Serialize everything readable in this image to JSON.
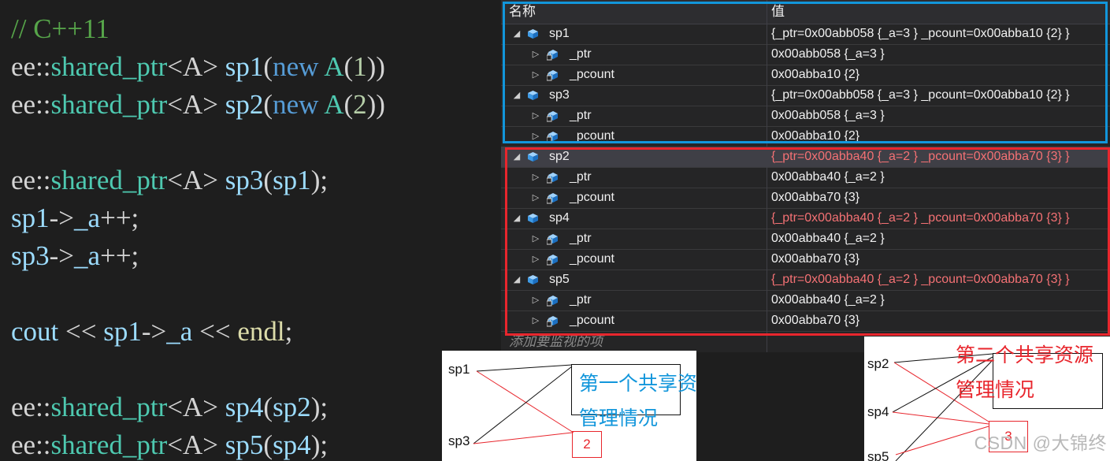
{
  "code": {
    "lines": [
      [
        {
          "t": "// C++11",
          "c": "comment"
        }
      ],
      [
        {
          "t": "ee",
          "c": "ns"
        },
        {
          "t": "::",
          "c": "op"
        },
        {
          "t": "shared_ptr",
          "c": "type"
        },
        {
          "t": "<A>",
          "c": "tpl"
        },
        {
          "t": " ",
          "c": "op"
        },
        {
          "t": "sp1",
          "c": "var"
        },
        {
          "t": "(",
          "c": "op"
        },
        {
          "t": "new",
          "c": "kw"
        },
        {
          "t": " ",
          "c": "op"
        },
        {
          "t": "A",
          "c": "type"
        },
        {
          "t": "(",
          "c": "op"
        },
        {
          "t": "1",
          "c": "num"
        },
        {
          "t": "))",
          "c": "op"
        }
      ],
      [
        {
          "t": "ee",
          "c": "ns"
        },
        {
          "t": "::",
          "c": "op"
        },
        {
          "t": "shared_ptr",
          "c": "type"
        },
        {
          "t": "<A>",
          "c": "tpl"
        },
        {
          "t": " ",
          "c": "op"
        },
        {
          "t": "sp2",
          "c": "var"
        },
        {
          "t": "(",
          "c": "op"
        },
        {
          "t": "new",
          "c": "kw"
        },
        {
          "t": " ",
          "c": "op"
        },
        {
          "t": "A",
          "c": "type"
        },
        {
          "t": "(",
          "c": "op"
        },
        {
          "t": "2",
          "c": "num"
        },
        {
          "t": "))",
          "c": "op"
        }
      ],
      [],
      [
        {
          "t": "ee",
          "c": "ns"
        },
        {
          "t": "::",
          "c": "op"
        },
        {
          "t": "shared_ptr",
          "c": "type"
        },
        {
          "t": "<A>",
          "c": "tpl"
        },
        {
          "t": " ",
          "c": "op"
        },
        {
          "t": "sp3",
          "c": "var"
        },
        {
          "t": "(",
          "c": "op"
        },
        {
          "t": "sp1",
          "c": "var"
        },
        {
          "t": ");",
          "c": "op"
        }
      ],
      [
        {
          "t": "sp1",
          "c": "var"
        },
        {
          "t": "->",
          "c": "op"
        },
        {
          "t": "_a",
          "c": "var"
        },
        {
          "t": "++;",
          "c": "op"
        }
      ],
      [
        {
          "t": "sp3",
          "c": "var"
        },
        {
          "t": "->",
          "c": "op"
        },
        {
          "t": "_a",
          "c": "var"
        },
        {
          "t": "++;",
          "c": "op"
        }
      ],
      [],
      [
        {
          "t": "cout",
          "c": "var"
        },
        {
          "t": " << ",
          "c": "op"
        },
        {
          "t": "sp1",
          "c": "var"
        },
        {
          "t": "->",
          "c": "op"
        },
        {
          "t": "_a",
          "c": "var"
        },
        {
          "t": " << ",
          "c": "op"
        },
        {
          "t": "endl",
          "c": "func"
        },
        {
          "t": ";",
          "c": "op"
        }
      ],
      [],
      [
        {
          "t": "ee",
          "c": "ns"
        },
        {
          "t": "::",
          "c": "op"
        },
        {
          "t": "shared_ptr",
          "c": "type"
        },
        {
          "t": "<A>",
          "c": "tpl"
        },
        {
          "t": " ",
          "c": "op"
        },
        {
          "t": "sp4",
          "c": "var"
        },
        {
          "t": "(",
          "c": "op"
        },
        {
          "t": "sp2",
          "c": "var"
        },
        {
          "t": ");",
          "c": "op"
        }
      ],
      [
        {
          "t": "ee",
          "c": "ns"
        },
        {
          "t": "::",
          "c": "op"
        },
        {
          "t": "shared_ptr",
          "c": "type"
        },
        {
          "t": "<A>",
          "c": "tpl"
        },
        {
          "t": " ",
          "c": "op"
        },
        {
          "t": "sp5",
          "c": "var"
        },
        {
          "t": "(",
          "c": "op"
        },
        {
          "t": "sp4",
          "c": "var"
        },
        {
          "t": ");",
          "c": "op"
        }
      ]
    ]
  },
  "watch": {
    "header_name": "名称",
    "header_value": "值",
    "add_placeholder": "添加要监视的项",
    "rows": [
      {
        "name": "sp1",
        "value": "{_ptr=0x00abb058 {_a=3 } _pcount=0x00abba10 {2} }",
        "level": 0,
        "changed": false,
        "selected": false
      },
      {
        "name": "_ptr",
        "value": "0x00abb058 {_a=3 }",
        "level": 1,
        "changed": false,
        "selected": false
      },
      {
        "name": "_pcount",
        "value": "0x00abba10 {2}",
        "level": 1,
        "changed": false,
        "selected": false
      },
      {
        "name": "sp3",
        "value": "{_ptr=0x00abb058 {_a=3 } _pcount=0x00abba10 {2} }",
        "level": 0,
        "changed": false,
        "selected": false
      },
      {
        "name": "_ptr",
        "value": "0x00abb058 {_a=3 }",
        "level": 1,
        "changed": false,
        "selected": false
      },
      {
        "name": "_pcount",
        "value": "0x00abba10 {2}",
        "level": 1,
        "changed": false,
        "selected": false
      },
      {
        "name": "sp2",
        "value": "{_ptr=0x00abba40 {_a=2 } _pcount=0x00abba70 {3} }",
        "level": 0,
        "changed": true,
        "selected": true
      },
      {
        "name": "_ptr",
        "value": "0x00abba40 {_a=2 }",
        "level": 1,
        "changed": false,
        "selected": false
      },
      {
        "name": "_pcount",
        "value": "0x00abba70 {3}",
        "level": 1,
        "changed": false,
        "selected": false
      },
      {
        "name": "sp4",
        "value": "{_ptr=0x00abba40 {_a=2 } _pcount=0x00abba70 {3} }",
        "level": 0,
        "changed": true,
        "selected": false
      },
      {
        "name": "_ptr",
        "value": "0x00abba40 {_a=2 }",
        "level": 1,
        "changed": false,
        "selected": false
      },
      {
        "name": "_pcount",
        "value": "0x00abba70 {3}",
        "level": 1,
        "changed": false,
        "selected": false
      },
      {
        "name": "sp5",
        "value": "{_ptr=0x00abba40 {_a=2 } _pcount=0x00abba70 {3} }",
        "level": 0,
        "changed": true,
        "selected": false
      },
      {
        "name": "_ptr",
        "value": "0x00abba40 {_a=2 }",
        "level": 1,
        "changed": false,
        "selected": false
      },
      {
        "name": "_pcount",
        "value": "0x00abba70 {3}",
        "level": 1,
        "changed": false,
        "selected": false
      }
    ]
  },
  "diagram1": {
    "labels": [
      "sp1",
      "sp3"
    ],
    "title_line1": "第一个共享资源",
    "title_line2": "管理情况",
    "count": "2",
    "title_color": "#1296db"
  },
  "diagram2": {
    "labels": [
      "sp2",
      "sp4",
      "sp5"
    ],
    "title_line1": "第二个共享资源",
    "title_line2": "管理情况",
    "count": "3",
    "title_color": "#e8262d"
  },
  "watermark": "CSDN @大锦终",
  "colors": {
    "blue_frame": "#1296db",
    "red_frame": "#e8262d",
    "changed_value": "#f47174"
  }
}
